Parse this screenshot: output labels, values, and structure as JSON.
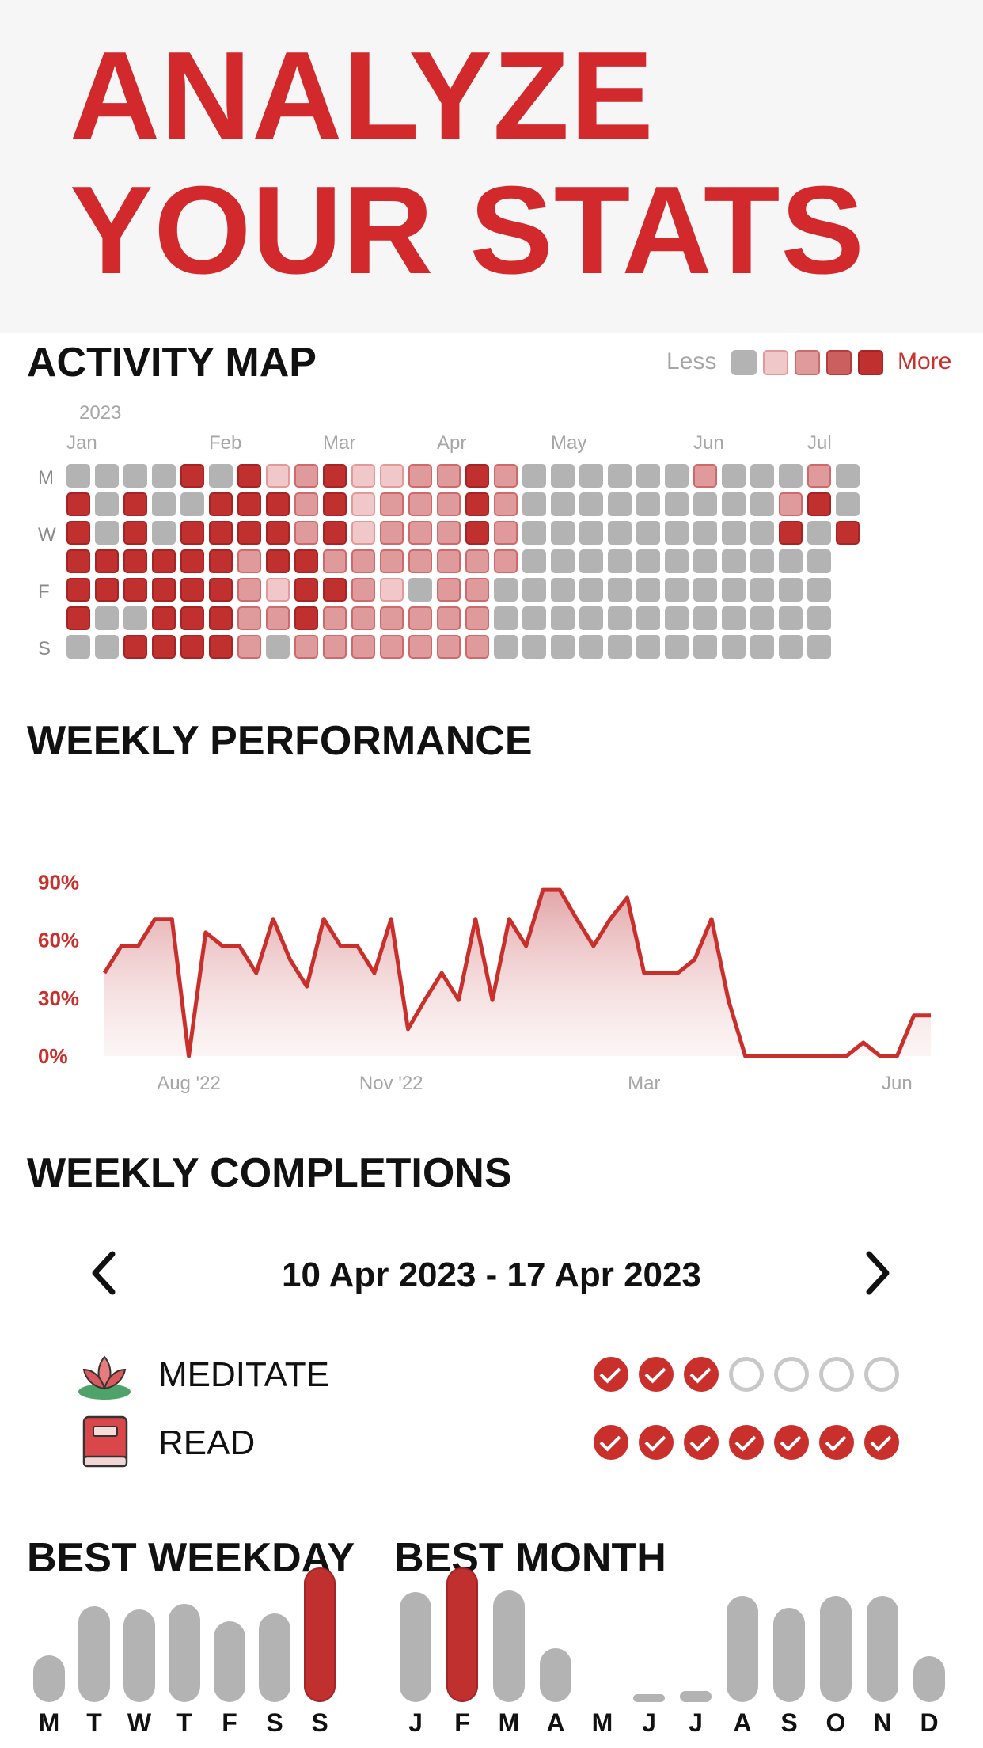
{
  "hero": {
    "line1": "ANALYZE",
    "line2": "YOUR STATS"
  },
  "activity_map": {
    "title": "ACTIVITY MAP",
    "legend_less": "Less",
    "legend_more": "More",
    "year_label": "2023",
    "month_labels": [
      "Jan",
      "Feb",
      "Mar",
      "Apr",
      "May",
      "Jun",
      "Jul"
    ],
    "day_labels": [
      "M",
      "W",
      "F",
      "S"
    ],
    "colors": [
      "#b3b3b3",
      "#f1c8c9",
      "#df9a9b",
      "#cb5e5f",
      "#c0302f"
    ],
    "weeks": [
      [
        0,
        4,
        4,
        4,
        4,
        4,
        0
      ],
      [
        0,
        0,
        0,
        4,
        4,
        0,
        0
      ],
      [
        0,
        4,
        4,
        4,
        4,
        0,
        4
      ],
      [
        0,
        0,
        0,
        4,
        4,
        4,
        4
      ],
      [
        4,
        0,
        4,
        4,
        4,
        4,
        4
      ],
      [
        0,
        4,
        4,
        4,
        4,
        4,
        4
      ],
      [
        4,
        4,
        4,
        2,
        2,
        2,
        2
      ],
      [
        1,
        4,
        4,
        4,
        1,
        2,
        0
      ],
      [
        2,
        2,
        2,
        4,
        4,
        4,
        2
      ],
      [
        4,
        4,
        4,
        2,
        4,
        2,
        2
      ],
      [
        1,
        1,
        1,
        2,
        2,
        2,
        2
      ],
      [
        1,
        2,
        2,
        2,
        1,
        2,
        2
      ],
      [
        2,
        2,
        2,
        2,
        0,
        2,
        2
      ],
      [
        2,
        2,
        2,
        2,
        2,
        2,
        2
      ],
      [
        4,
        4,
        4,
        2,
        2,
        2,
        2
      ],
      [
        2,
        2,
        2,
        2,
        0,
        0,
        0
      ],
      [
        0,
        0,
        0,
        0,
        0,
        0,
        0
      ],
      [
        0,
        0,
        0,
        0,
        0,
        0,
        0
      ],
      [
        0,
        0,
        0,
        0,
        0,
        0,
        0
      ],
      [
        0,
        0,
        0,
        0,
        0,
        0,
        0
      ],
      [
        0,
        0,
        0,
        0,
        0,
        0,
        0
      ],
      [
        0,
        0,
        0,
        0,
        0,
        0,
        0
      ],
      [
        2,
        0,
        0,
        0,
        0,
        0,
        0
      ],
      [
        0,
        0,
        0,
        0,
        0,
        0,
        0
      ],
      [
        0,
        0,
        0,
        0,
        0,
        0,
        0
      ],
      [
        0,
        2,
        4,
        0,
        0,
        0,
        0
      ],
      [
        2,
        4,
        0,
        0,
        0,
        0,
        0
      ],
      [
        0,
        0,
        4
      ]
    ]
  },
  "weekly_performance": {
    "title": "WEEKLY PERFORMANCE"
  },
  "chart_data": {
    "type": "area",
    "y_tick_labels": [
      "90%",
      "60%",
      "30%",
      "0%"
    ],
    "ylim": [
      0,
      100
    ],
    "x_tick_labels": [
      "Aug '22",
      "Nov '22",
      "Mar",
      "Jun"
    ],
    "x_tick_positions": [
      5,
      17,
      32,
      47
    ],
    "values": [
      43,
      57,
      57,
      71,
      71,
      0,
      64,
      57,
      57,
      43,
      71,
      50,
      36,
      71,
      57,
      57,
      43,
      71,
      14,
      29,
      43,
      29,
      71,
      29,
      71,
      57,
      86,
      86,
      71,
      57,
      71,
      82,
      43,
      43,
      43,
      50,
      71,
      29,
      0,
      0,
      0,
      0,
      0,
      0,
      0,
      7,
      0,
      0,
      21,
      21
    ],
    "color": "#c9302c",
    "grid": false
  },
  "weekly_completions": {
    "title": "WEEKLY COMPLETIONS",
    "date_range": "10 Apr 2023 - 17 Apr 2023",
    "habits": [
      {
        "name": "MEDITATE",
        "icon": "lotus-icon",
        "days": [
          true,
          true,
          true,
          false,
          false,
          false,
          false
        ]
      },
      {
        "name": "READ",
        "icon": "book-icon",
        "days": [
          true,
          true,
          true,
          true,
          true,
          true,
          true
        ]
      }
    ]
  },
  "best_weekday": {
    "title": "BEST WEEKDAY",
    "labels": [
      "M",
      "T",
      "W",
      "T",
      "F",
      "S",
      "S"
    ],
    "values": [
      0.35,
      0.71,
      0.69,
      0.73,
      0.6,
      0.66,
      1.0
    ],
    "highlight_index": 6
  },
  "best_month": {
    "title": "BEST MONTH",
    "labels": [
      "J",
      "F",
      "M",
      "A",
      "M",
      "J",
      "J",
      "A",
      "S",
      "O",
      "N",
      "D"
    ],
    "values": [
      0.82,
      1.0,
      0.83,
      0.4,
      0.0,
      0.06,
      0.08,
      0.79,
      0.7,
      0.79,
      0.79,
      0.34
    ],
    "highlight_index": 1
  }
}
